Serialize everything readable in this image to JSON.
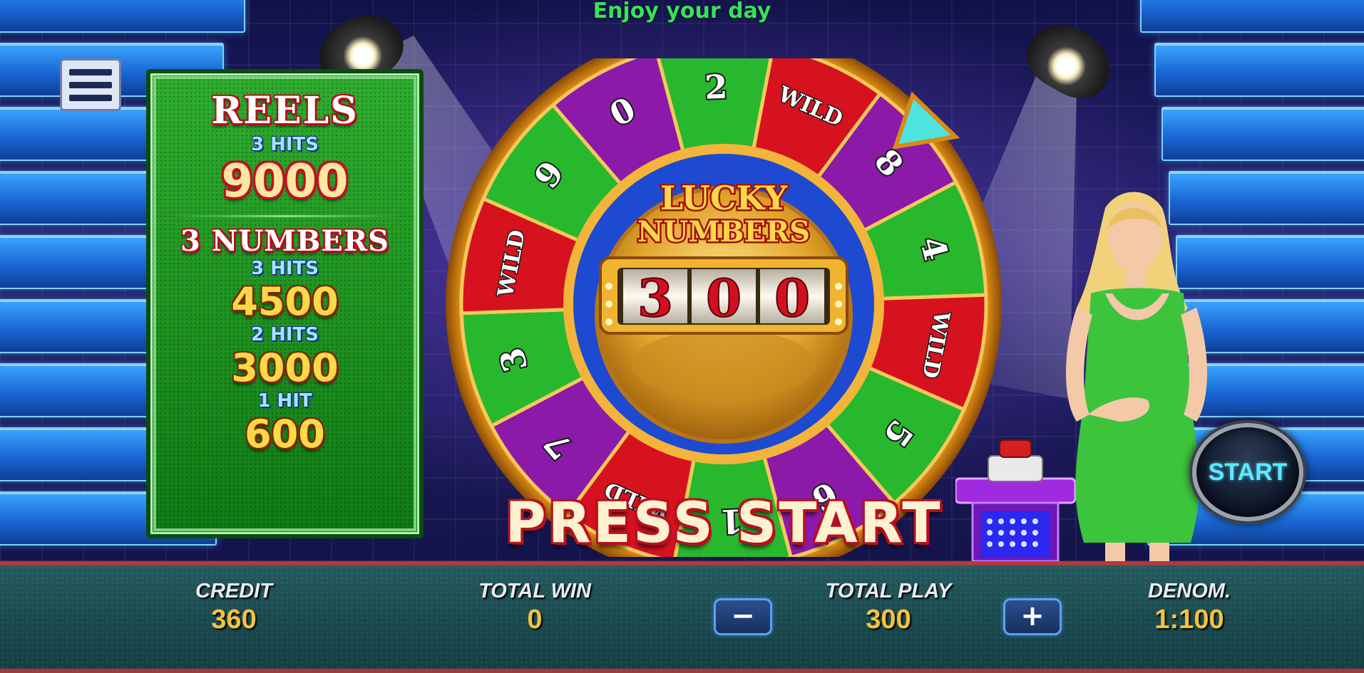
{
  "header": {
    "marquee": "Enjoy your day"
  },
  "menu": {
    "icon": "menu-icon"
  },
  "paytable": {
    "reels_title": "REELS",
    "reels_hits_label": "3 HITS",
    "reels_value": "9000",
    "numbers_title": "3 NUMBERS",
    "tiers": [
      {
        "hits": "3 HITS",
        "value": "4500"
      },
      {
        "hits": "2 HITS",
        "value": "3000"
      },
      {
        "hits": "1 HIT",
        "value": "600"
      }
    ]
  },
  "wheel": {
    "logo_line1": "LUCKY",
    "logo_line2": "NUMBERS",
    "reel_digits": [
      "3",
      "0",
      "0"
    ],
    "segments": [
      {
        "label": "2",
        "color": "#27b82e"
      },
      {
        "label": "WILD",
        "color": "#d6121f"
      },
      {
        "label": "8",
        "color": "#8b1aa8"
      },
      {
        "label": "4",
        "color": "#27b82e"
      },
      {
        "label": "WILD",
        "color": "#d6121f"
      },
      {
        "label": "5",
        "color": "#27b82e"
      },
      {
        "label": "6",
        "color": "#8b1aa8"
      },
      {
        "label": "1",
        "color": "#27b82e"
      },
      {
        "label": "WILD",
        "color": "#d6121f"
      },
      {
        "label": "7",
        "color": "#8b1aa8"
      },
      {
        "label": "3",
        "color": "#27b82e"
      },
      {
        "label": "WILD",
        "color": "#d6121f"
      },
      {
        "label": "9",
        "color": "#27b82e"
      },
      {
        "label": "0",
        "color": "#8b1aa8"
      }
    ]
  },
  "prompt": {
    "text": "PRESS START"
  },
  "controls": {
    "start_label": "START",
    "decrease_label": "−",
    "increase_label": "+"
  },
  "meters": {
    "credit_label": "CREDIT",
    "credit_value": "360",
    "total_win_label": "TOTAL WIN",
    "total_win_value": "0",
    "total_play_label": "TOTAL PLAY",
    "total_play_value": "300",
    "denom_label": "DENOM.",
    "denom_value": "1:100"
  },
  "colors": {
    "marquee_text": "#38e25a",
    "meter_value": "#f2c23c",
    "start_text": "#5ee8ff"
  }
}
